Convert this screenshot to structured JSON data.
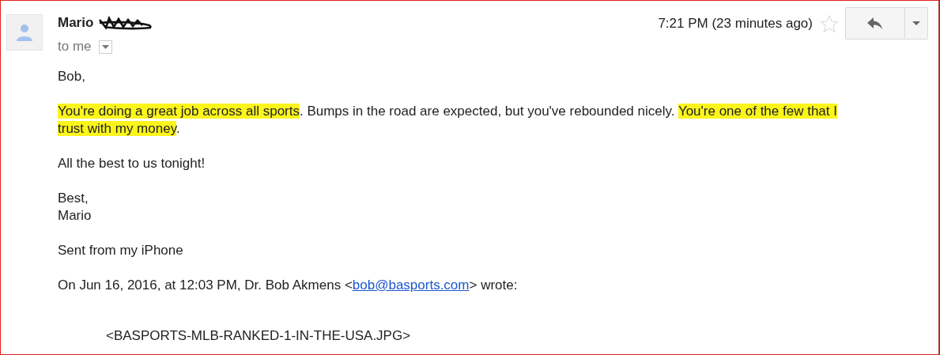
{
  "header": {
    "sender": "Mario",
    "recipient": "to me",
    "time": "7:21 PM (23 minutes ago)",
    "starred": false
  },
  "body": {
    "greeting": "Bob,",
    "paragraph": [
      {
        "text": "You're doing a great job across all sports",
        "highlighted": true
      },
      {
        "text": ". Bumps in the road are expected, but you've rebounded nicely. ",
        "highlighted": false
      },
      {
        "text": "You're one of the few that I trust with my money",
        "highlighted": true
      },
      {
        "text": ".",
        "highlighted": false
      }
    ],
    "wish": "All the best to us tonight!",
    "closing": [
      "Best,",
      "Mario"
    ],
    "signature": "Sent from my iPhone",
    "quote_header": {
      "before": "On Jun 16, 2016, at 12:03 PM, Dr. Bob Akmens <",
      "link": "bob@basports.com",
      "after": "> wrote:"
    },
    "attachment": "<BASPORTS-MLB-RANKED-1-IN-THE-USA.JPG>"
  }
}
